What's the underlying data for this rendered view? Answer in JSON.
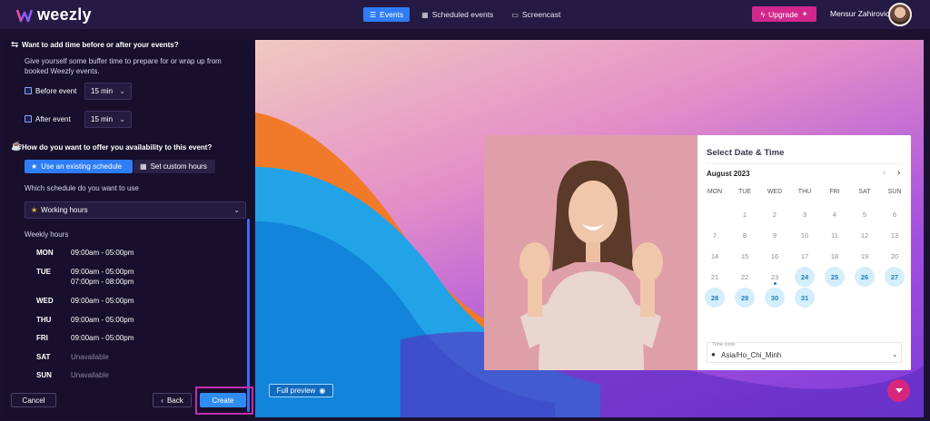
{
  "app": {
    "name": "weezly"
  },
  "nav": {
    "events": "Events",
    "scheduled": "Scheduled events",
    "screencast": "Screencast"
  },
  "header": {
    "upgrade": "Upgrade",
    "user": "Mensur Zahirovic"
  },
  "buffer": {
    "question": "Want to add time before or after your events?",
    "description": "Give yourself some buffer time to prepare for or wrap up from booked Weezly events.",
    "before_label": "Before event",
    "before_value": "15 min",
    "after_label": "After event",
    "after_value": "15 min"
  },
  "availability": {
    "question": "How do you want to offer you availability to this event?",
    "use_existing": "Use an existing schedule",
    "custom": "Set custom hours",
    "which_label": "Which schedule do you want to use",
    "schedule_value": "Working hours",
    "weekly_label": "Weekly hours",
    "days": [
      {
        "day": "MON",
        "hours": "09:00am - 05:00pm"
      },
      {
        "day": "TUE",
        "hours": "09:00am - 05:00pm",
        "hours2": "07:00pm - 08:00pm"
      },
      {
        "day": "WED",
        "hours": "09:00am - 05:00pm"
      },
      {
        "day": "THU",
        "hours": "09:00am - 05:00pm"
      },
      {
        "day": "FRI",
        "hours": "09:00am - 05:00pm"
      },
      {
        "day": "SAT",
        "hours": "Unavailable"
      },
      {
        "day": "SUN",
        "hours": "Unavailable"
      }
    ]
  },
  "footer": {
    "cancel": "Cancel",
    "back": "Back",
    "create": "Create"
  },
  "preview": {
    "full_preview": "Full preview",
    "title": "Select Date & Time",
    "month": "August 2023",
    "weekdays": [
      "MON",
      "TUE",
      "WED",
      "THU",
      "FRI",
      "SAT",
      "SUN"
    ],
    "weeks": [
      [
        "",
        "1",
        "2",
        "3",
        "4",
        "5",
        "6"
      ],
      [
        "7",
        "8",
        "9",
        "10",
        "11",
        "12",
        "13"
      ],
      [
        "14",
        "15",
        "16",
        "17",
        "18",
        "19",
        "20"
      ],
      [
        "21",
        "22",
        "23",
        "24",
        "25",
        "26",
        "27"
      ],
      [
        "28",
        "29",
        "30",
        "31",
        "",
        "",
        ""
      ]
    ],
    "available_days": [
      "24",
      "25",
      "26",
      "27",
      "28",
      "29",
      "30",
      "31"
    ],
    "today": "23",
    "timezone_label": "Time zone",
    "timezone": "Asia/Ho_Chi_Minh"
  },
  "colors": {
    "accent": "#2f7df6",
    "brand": "#d2288e",
    "available_day": "#d5eefb"
  }
}
